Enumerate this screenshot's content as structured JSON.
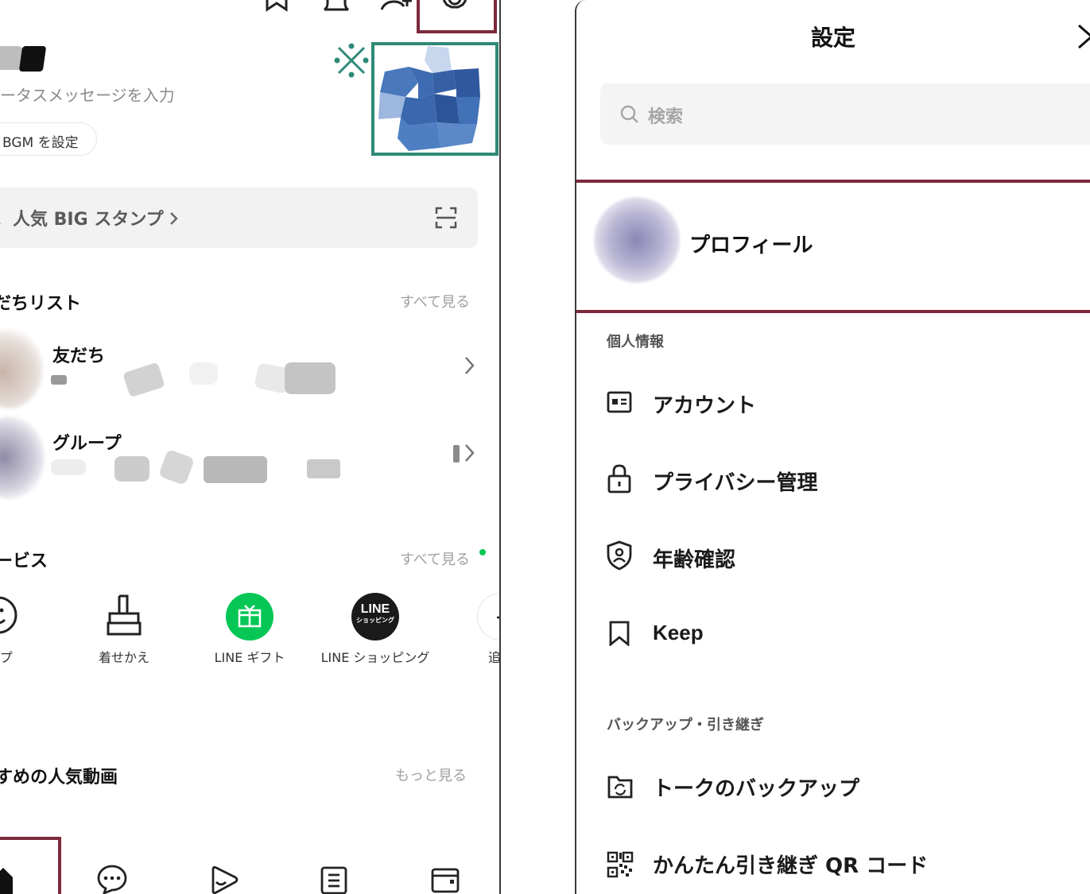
{
  "home": {
    "status_message": "ータスメッセージを入力",
    "bgm_label": "BGM を設定",
    "search_label": "人気 BIG スタンプ",
    "friends_section_title": "だちリスト",
    "friends_see_all": "すべて見る",
    "friends_row_label": "友だち",
    "groups_row_label": "グループ",
    "services_section_title": "ービス",
    "services_see_all": "すべて見る",
    "services": [
      {
        "label": "ンプ",
        "icon": "smiley-icon"
      },
      {
        "label": "着せかえ",
        "icon": "brush-icon"
      },
      {
        "label": "LINE ギフト",
        "icon": "gift-icon"
      },
      {
        "label": "LINE ショッピング",
        "icon": "line-shopping-icon"
      },
      {
        "label": "追",
        "icon": "add-icon"
      }
    ],
    "line_shopping_badge_top": "LINE",
    "line_shopping_badge_bottom": "ショッピング",
    "videos_section_title": "すめの人気動画",
    "videos_more": "もっと見る",
    "overlay_mark": "※"
  },
  "settings": {
    "title": "設定",
    "search_placeholder": "検索",
    "profile_label": "プロフィール",
    "group_personal": "個人情報",
    "menu_personal": [
      {
        "label": "アカウント",
        "icon": "id-card-icon"
      },
      {
        "label": "プライバシー管理",
        "icon": "lock-icon"
      },
      {
        "label": "年齢確認",
        "icon": "age-shield-icon"
      },
      {
        "label": "Keep",
        "icon": "bookmark-icon"
      }
    ],
    "group_backup": "バックアップ・引き継ぎ",
    "menu_backup": [
      {
        "label": "トークのバックアップ",
        "icon": "folder-sync-icon"
      },
      {
        "label": "かんたん引き継ぎ QR コード",
        "icon": "qr-code-icon"
      }
    ]
  },
  "colors": {
    "highlight_red": "#7d2a3c",
    "highlight_green": "#2f8a78",
    "line_green": "#06c755",
    "new_dot": "#06c755"
  }
}
